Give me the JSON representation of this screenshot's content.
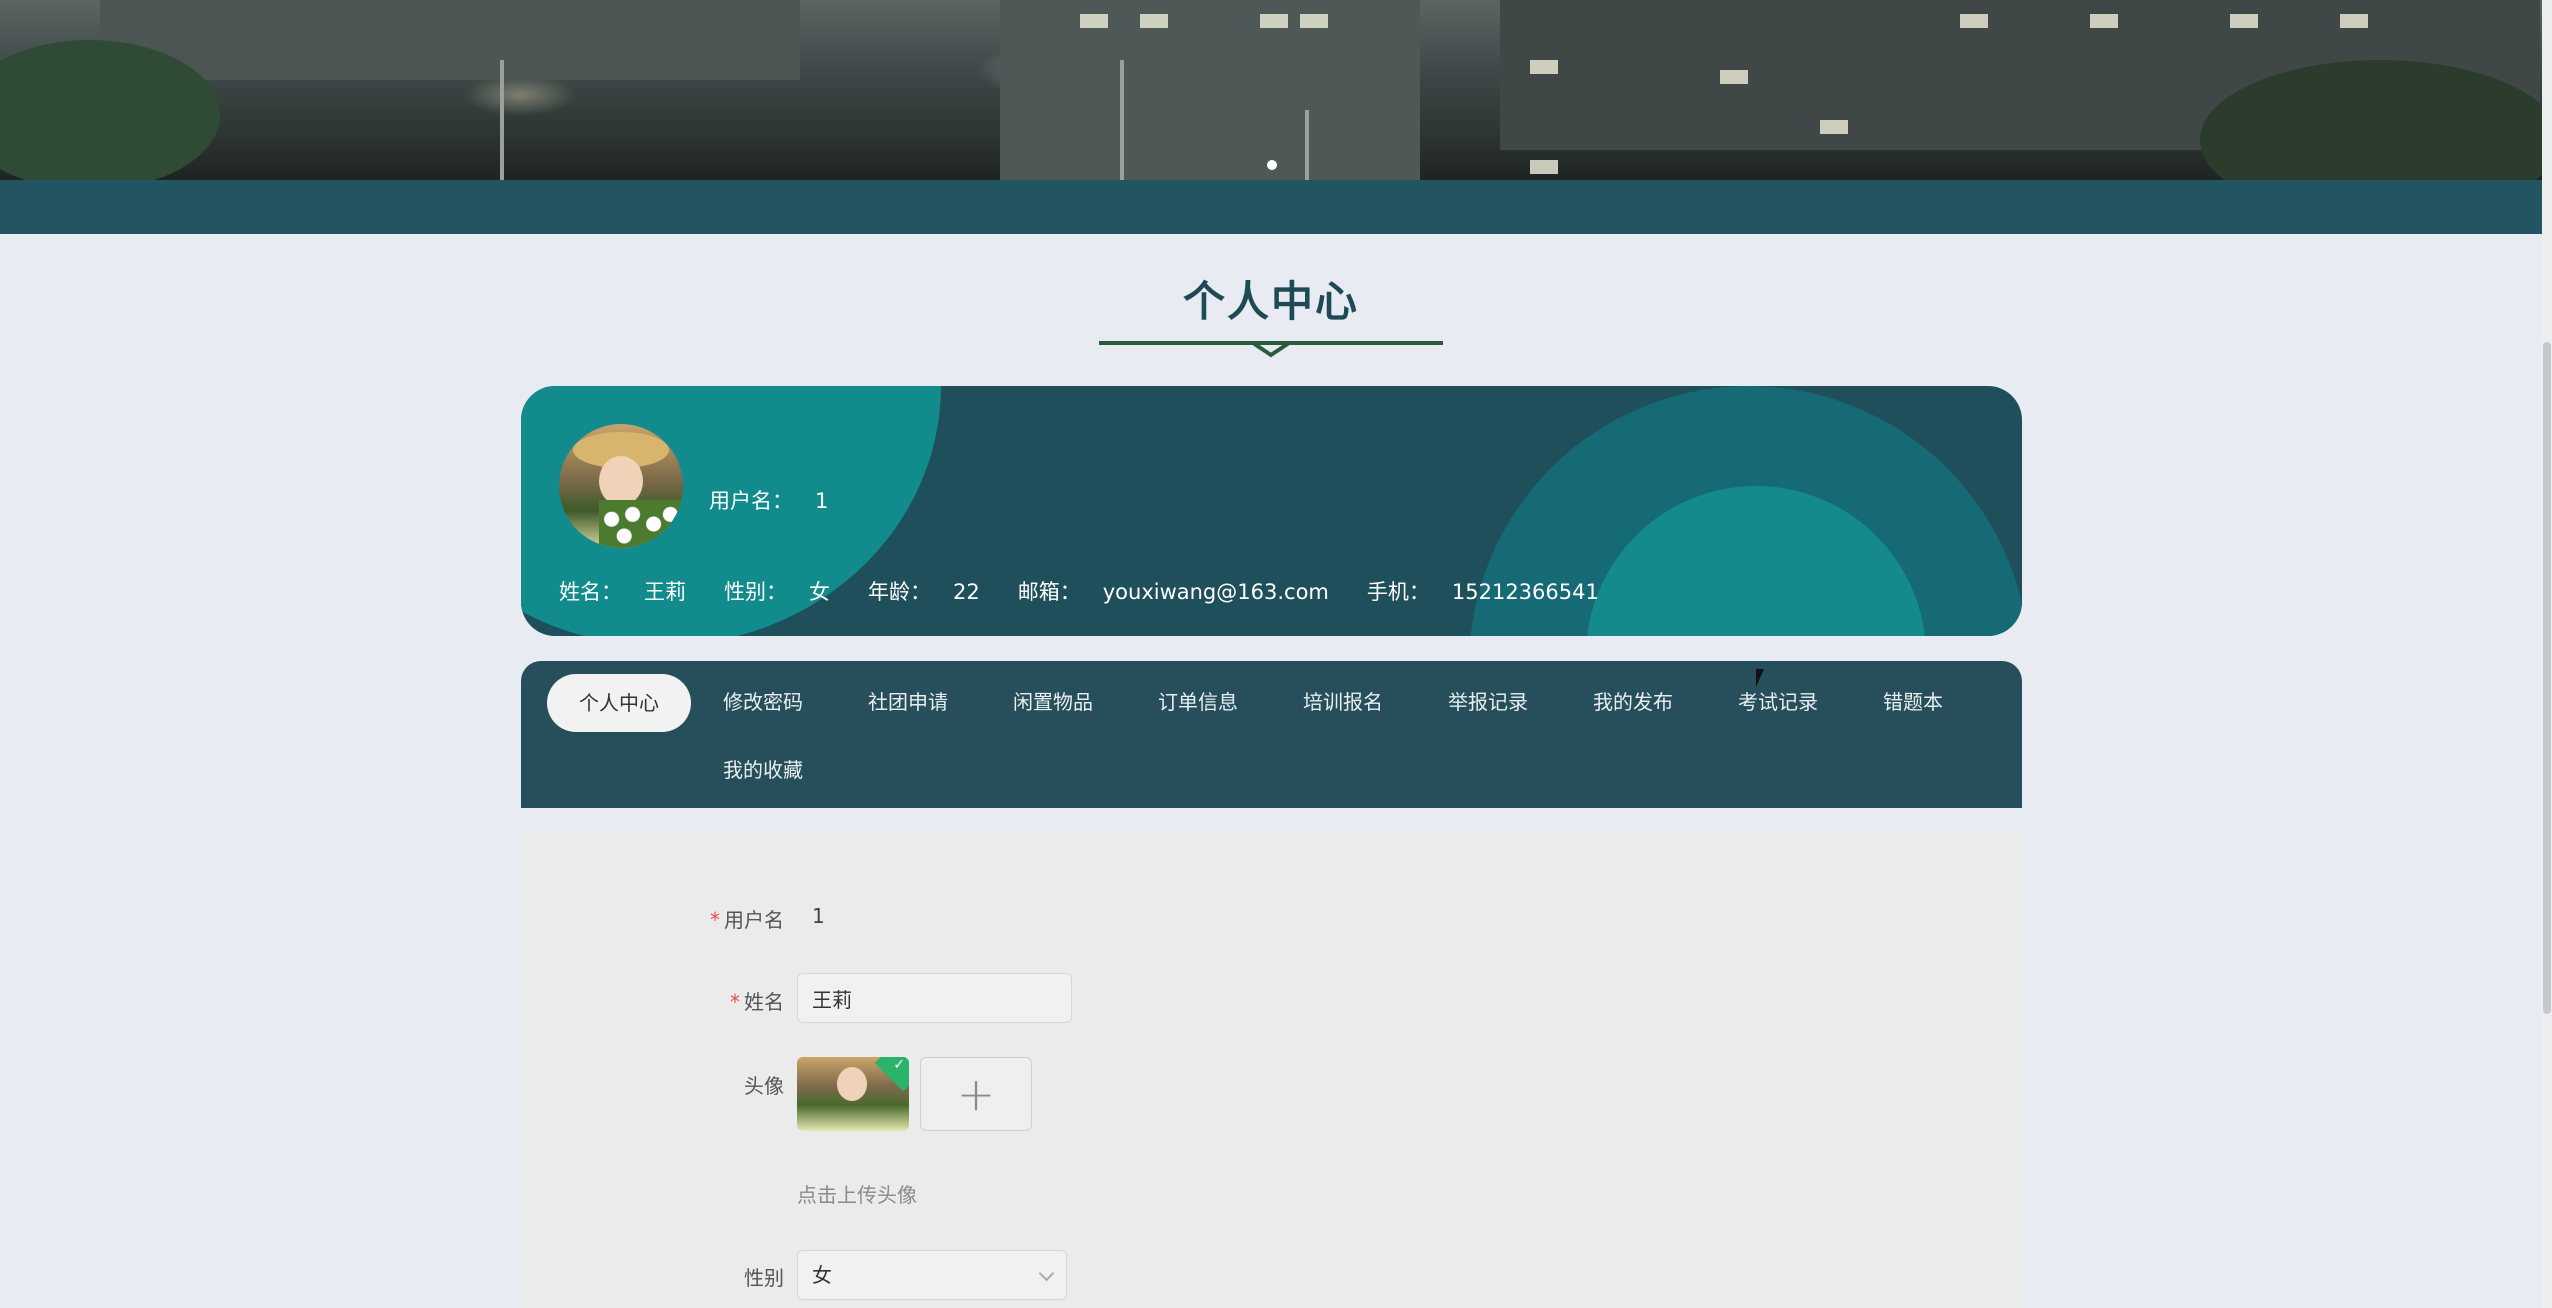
{
  "page": {
    "title": "个人中心"
  },
  "profile": {
    "username_label": "用户名：",
    "username_value": "1",
    "name_label": "姓名：",
    "name_value": "王莉",
    "gender_label": "性别：",
    "gender_value": "女",
    "age_label": "年龄：",
    "age_value": "22",
    "email_label": "邮箱：",
    "email_value": "youxiwang@163.com",
    "phone_label": "手机：",
    "phone_value": "15212366541"
  },
  "tabs": [
    {
      "label": "个人中心",
      "active": true
    },
    {
      "label": "修改密码"
    },
    {
      "label": "社团申请"
    },
    {
      "label": "闲置物品"
    },
    {
      "label": "订单信息"
    },
    {
      "label": "培训报名"
    },
    {
      "label": "举报记录"
    },
    {
      "label": "我的发布"
    },
    {
      "label": "考试记录"
    },
    {
      "label": "错题本"
    },
    {
      "label": "我的收藏"
    }
  ],
  "form": {
    "username_label": "用户名",
    "username_value": "1",
    "name_label": "姓名",
    "name_value": "王莉",
    "avatar_label": "头像",
    "upload_plus": "+",
    "upload_hint": "点击上传头像",
    "gender_label": "性别",
    "gender_value": "女",
    "required_mark": "*"
  },
  "colors": {
    "header_strip": "#235461",
    "card_bg": "#1f4f5a",
    "accent_teal": "#128b8d",
    "title_color": "#1e4a55"
  }
}
